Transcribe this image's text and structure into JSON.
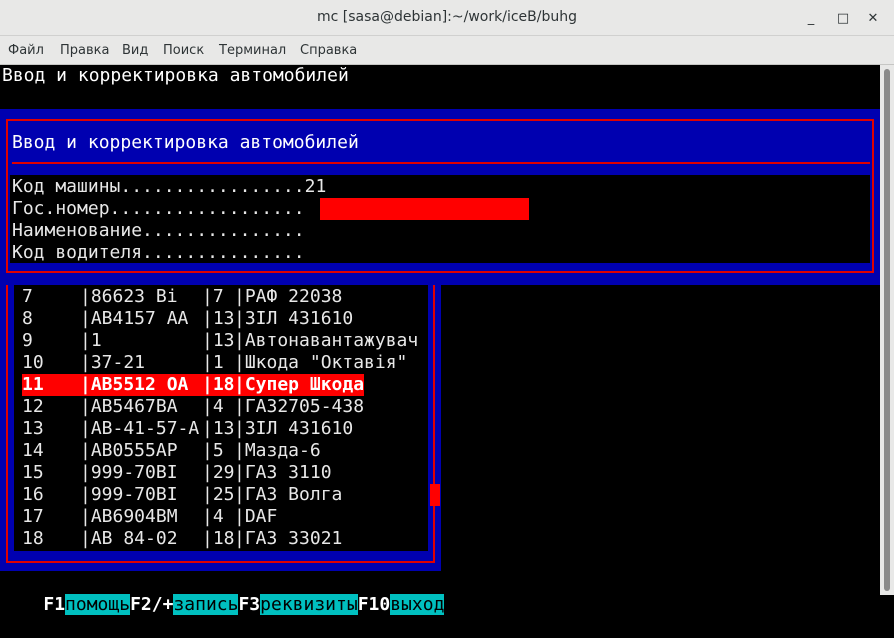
{
  "window": {
    "title": "mc [sasa@debian]:~/work/iceB/buhg",
    "minimize": "_",
    "maximize": "□",
    "close": "✕"
  },
  "menu": [
    "Файл",
    "Правка",
    "Вид",
    "Поиск",
    "Терминал",
    "Справка"
  ],
  "screen_title": "Ввод и корректировка автомобилей",
  "dialog": {
    "title": "Ввод и корректировка автомобилей",
    "fields": [
      {
        "label": "Код машины.................",
        "value": "21"
      },
      {
        "label": "Гос.номер..................",
        "value": ""
      },
      {
        "label": "Наименование...............",
        "value": ""
      },
      {
        "label": "Код водителя...............",
        "value": ""
      }
    ]
  },
  "list": {
    "rows": [
      [
        "7",
        "|86623 Bi ",
        "|7 ",
        "|РАФ 22038"
      ],
      [
        "8",
        "|AB4157 AA",
        "|13",
        "|ЗІЛ 431610"
      ],
      [
        "9",
        "|1",
        "|13",
        "|Автонавантажувач"
      ],
      [
        "10",
        "|37-21",
        "|1 ",
        "|Шкода \"Октавія\""
      ],
      [
        "11",
        "|AB5512 OA",
        "|18",
        "|Супер Шкода"
      ],
      [
        "12",
        "|AB5467BA",
        "|4 ",
        "|ГА32705-438"
      ],
      [
        "13",
        "|AB-41-57-A",
        "|13",
        "|ЗІЛ 431610"
      ],
      [
        "14",
        "|AB0555AP",
        "|5 ",
        "|Мазда-6"
      ],
      [
        "15",
        "|999-70BI",
        "|29",
        "|ГАЗ 3110"
      ],
      [
        "16",
        "|999-70BI",
        "|25",
        "|ГАЗ Волга"
      ],
      [
        "17",
        "|AB6904BM",
        "|4 ",
        "|DAF"
      ],
      [
        "18",
        "|AB 84-02",
        "|18",
        "|ГАЗ 33021"
      ]
    ],
    "selected_index": 4
  },
  "function_keys": [
    {
      "key": "F1",
      "label": "помощь"
    },
    {
      "key": "F2/+",
      "label": "запись"
    },
    {
      "key": "F3",
      "label": "реквизиты"
    },
    {
      "key": "F10",
      "label": "выход"
    }
  ],
  "colors": {
    "dialog_bg": "#0000b0",
    "border": "#e00000",
    "selection": "#ff0000",
    "fkey_label_bg": "#00c0c0"
  }
}
